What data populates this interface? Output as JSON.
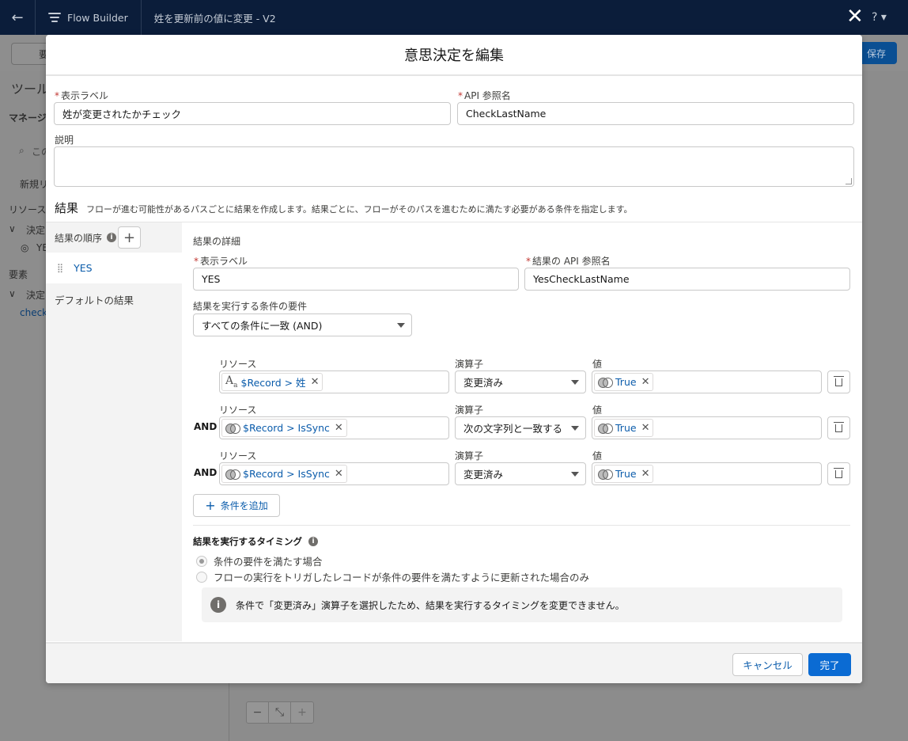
{
  "topbar": {
    "brand": "Flow Builder",
    "flow_title": "姓を更新前の値に変更 - V2",
    "close_glyph": "✕",
    "help_glyph": "? ▾"
  },
  "background": {
    "toolbar_partial": "要",
    "save_label": "保存",
    "sidebar_title": "ツール",
    "sidebar_tab": "マネージ",
    "search_partial": "この",
    "new_resource_partial": "新規リ",
    "resources_label": "リソース",
    "decision_group_1": "決定",
    "decision_item_1": "YE",
    "elements_label": "要素",
    "decision_group_2": "決定",
    "decision_item_2": "check",
    "canvas_minus": "−",
    "canvas_fit": "⤡",
    "canvas_plus": "+"
  },
  "modal": {
    "title": "意思決定を編集",
    "label_field": {
      "label": "表示ラベル",
      "value": "姓が変更されたかチェック"
    },
    "api_field": {
      "label": "API 参照名",
      "value": "CheckLastName"
    },
    "description_label": "説明",
    "outcomes_title": "結果",
    "outcomes_description": "フローが進む可能性があるパスごとに結果を作成します。結果ごとに、フローがそのパスを進むために満たす必要がある条件を指定します。",
    "outcome_order_label": "結果の順序",
    "outcomes": [
      {
        "name": "YES"
      }
    ],
    "default_outcome_label": "デフォルトの結果",
    "details": {
      "title": "結果の詳細",
      "label_field": {
        "label": "表示ラベル",
        "value": "YES"
      },
      "api_field": {
        "label": "結果の API 参照名",
        "value": "YesCheckLastName"
      },
      "condition_req_label": "結果を実行する条件の要件",
      "condition_req_value": "すべての条件に一致 (AND)",
      "resource_header": "リソース",
      "operator_header": "演算子",
      "value_header": "値",
      "and_label": "AND",
      "conditions": [
        {
          "resource": "$Record > 姓",
          "operator": "変更済み",
          "value": "True"
        },
        {
          "resource": "$Record > IsSync",
          "operator": "次の文字列と一致する",
          "value": "True"
        },
        {
          "resource": "$Record > IsSync",
          "operator": "変更済み",
          "value": "True"
        }
      ],
      "add_condition_label": "条件を追加",
      "timing_title": "結果を実行するタイミング",
      "timing_options": [
        "条件の要件を満たす場合",
        "フローの実行をトリガしたレコードが条件の要件を満たすように更新された場合のみ"
      ],
      "notice": "条件で「変更済み」演算子を選択したため、結果を実行するタイミングを変更できません。"
    },
    "cancel_label": "キャンセル",
    "done_label": "完了"
  },
  "colors": {
    "brand_blue": "#0b6bd3",
    "link_blue": "#0b5cab",
    "required_red": "#c23934",
    "topbar": "#0b1d3a"
  }
}
